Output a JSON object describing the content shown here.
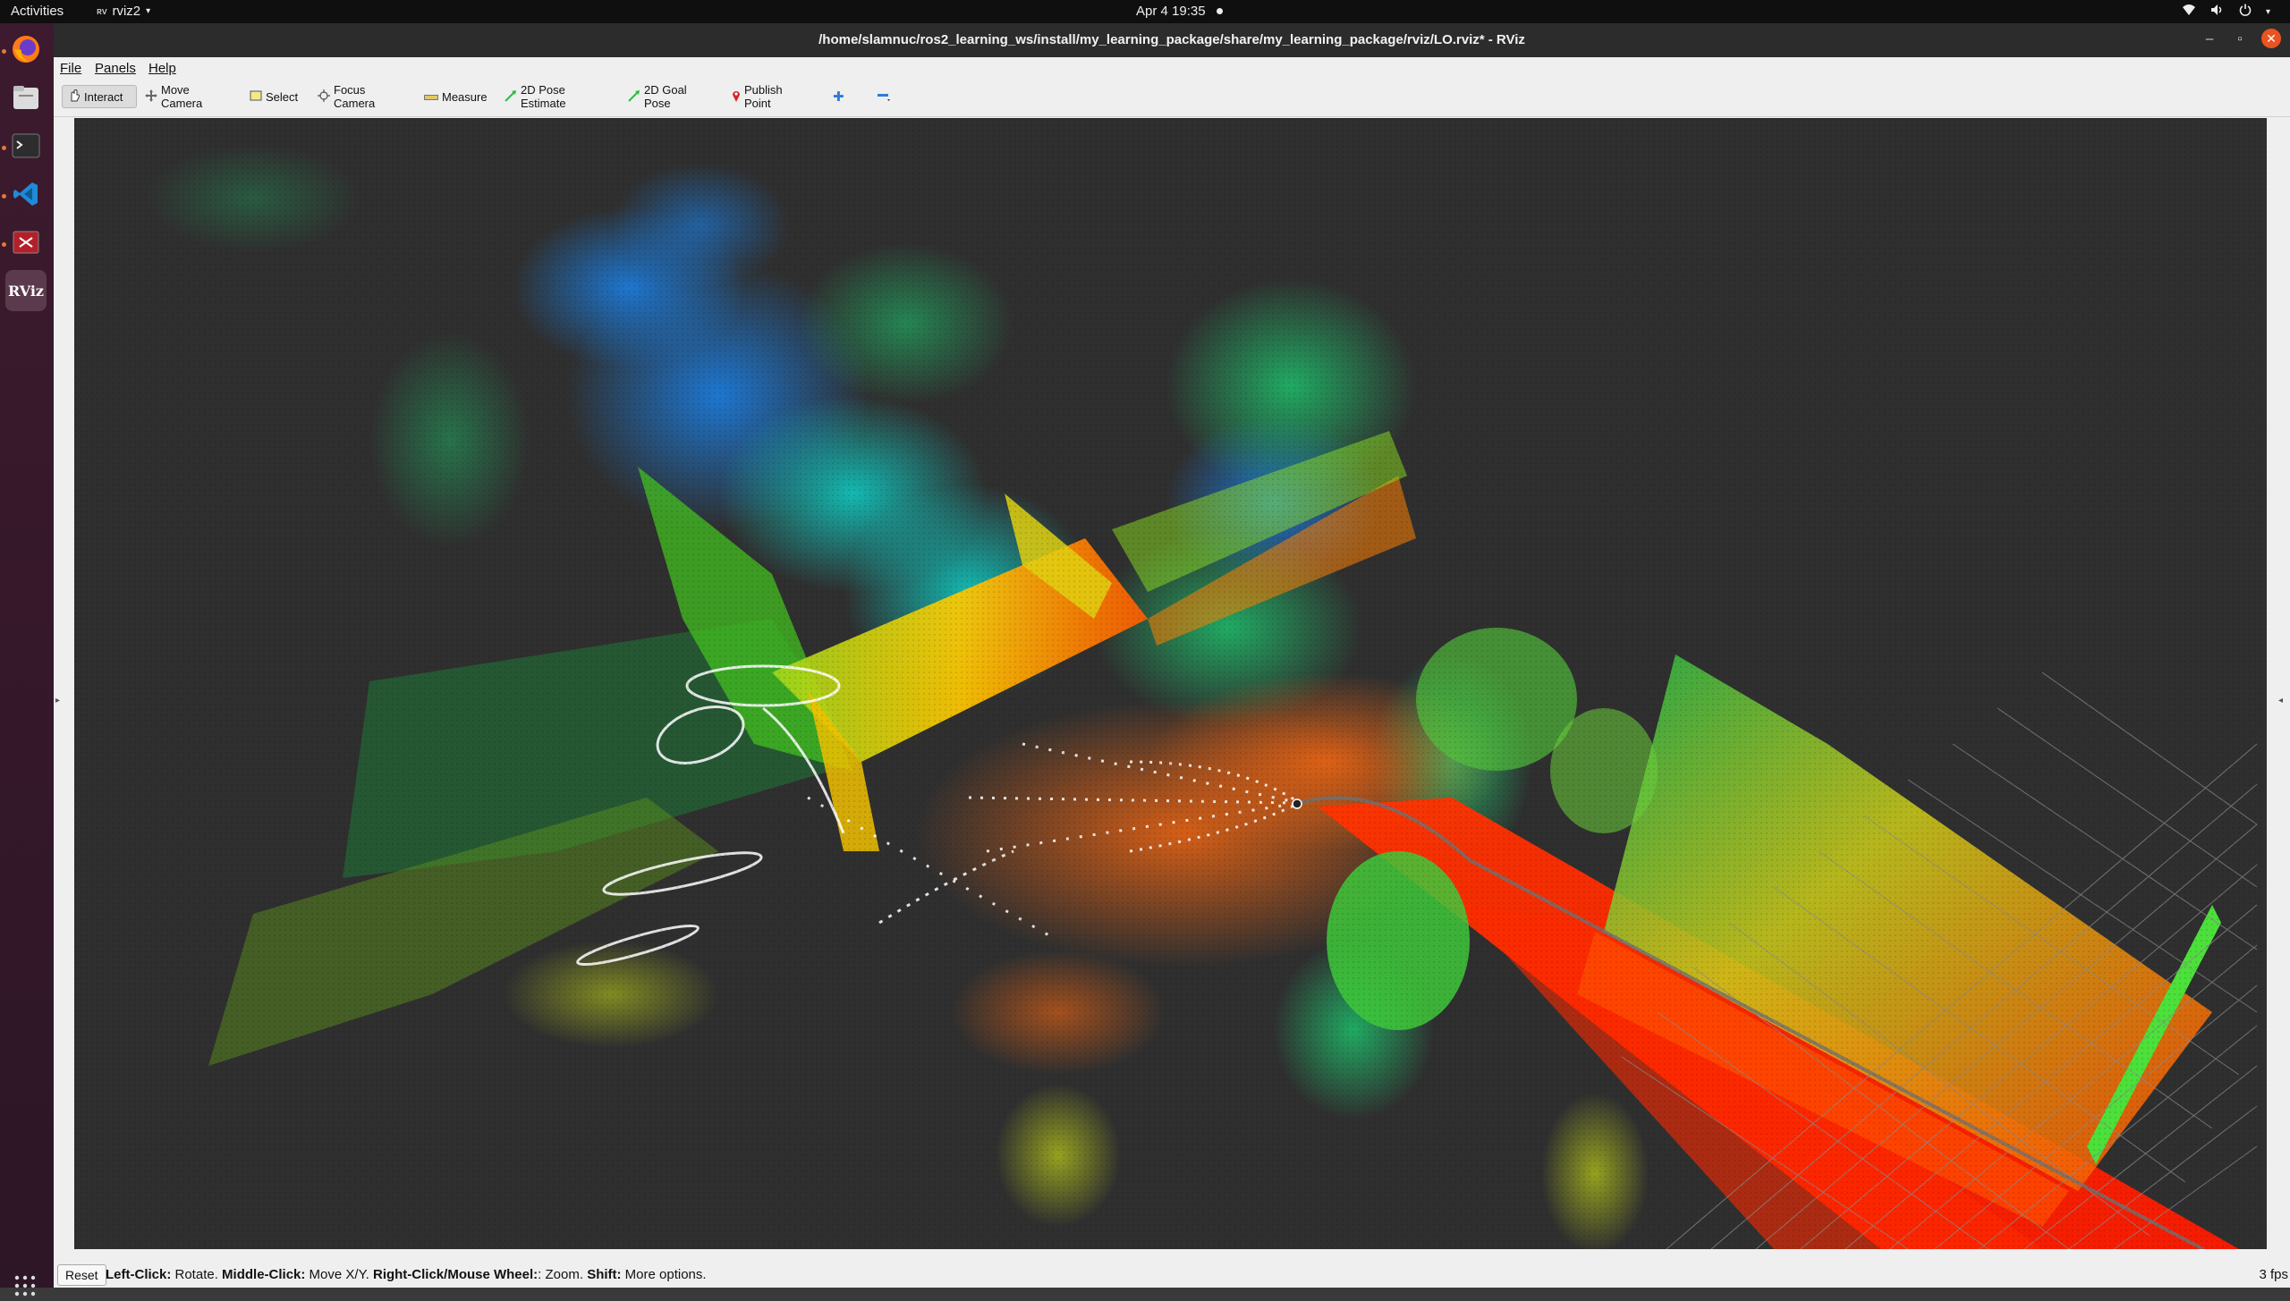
{
  "topbar": {
    "activities": "Activities",
    "app_name": "rviz2",
    "clock": "Apr 4  19:35"
  },
  "dock": {
    "apps": [
      "firefox-icon",
      "files-icon",
      "terminal-icon",
      "vscode-icon",
      "screen-recorder-icon",
      "rviz-icon"
    ],
    "rviz_label": "RViz"
  },
  "window": {
    "title": "/home/slamnuc/ros2_learning_ws/install/my_learning_package/share/my_learning_package/rviz/LO.rviz* - RViz"
  },
  "menu": {
    "file": "File",
    "panels": "Panels",
    "help": "Help"
  },
  "toolbar": {
    "interact": "Interact",
    "move_camera": "Move Camera",
    "select": "Select",
    "focus_camera": "Focus Camera",
    "measure": "Measure",
    "pose_estimate": "2D Pose Estimate",
    "goal_pose": "2D Goal Pose",
    "publish_point": "Publish Point"
  },
  "status": {
    "reset": "Reset",
    "hint_left_click": "Left-Click:",
    "hint_rotate": " Rotate. ",
    "hint_middle_click": "Middle-Click:",
    "hint_move": " Move X/Y. ",
    "hint_right_click": "Right-Click/Mouse Wheel:",
    "hint_zoom": ": Zoom. ",
    "hint_shift": "Shift:",
    "hint_more": " More options.",
    "fps": "3 fps"
  },
  "colors": {
    "accent": "#e95420",
    "viewport_bg": "#2f2f2f"
  }
}
